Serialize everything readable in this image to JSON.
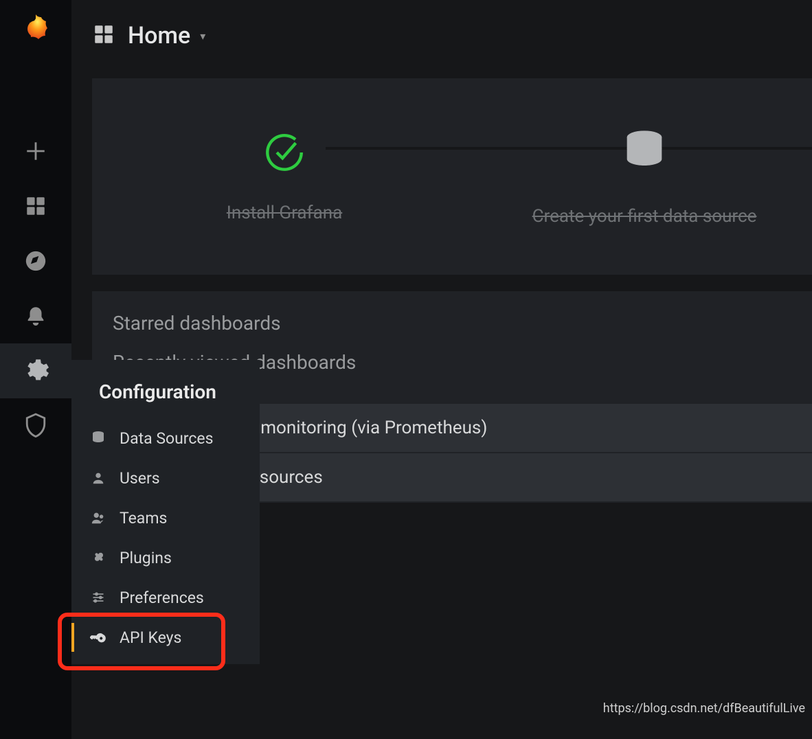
{
  "topbar": {
    "title": "Home"
  },
  "setup": {
    "steps": [
      {
        "label": "Install Grafana",
        "done": true,
        "icon": "check"
      },
      {
        "label": "Create your first data source",
        "done": true,
        "icon": "database"
      }
    ]
  },
  "sections": {
    "starred_title": "Starred dashboards",
    "recent_title": "Recently viewed dashboards",
    "rows": [
      "r monitoring (via Prometheus)",
      "esources"
    ]
  },
  "flyout": {
    "title": "Configuration",
    "items": [
      {
        "label": "Data Sources",
        "icon": "database"
      },
      {
        "label": "Users",
        "icon": "user"
      },
      {
        "label": "Teams",
        "icon": "users"
      },
      {
        "label": "Plugins",
        "icon": "plug"
      },
      {
        "label": "Preferences",
        "icon": "sliders"
      },
      {
        "label": "API Keys",
        "icon": "key",
        "selected": true
      }
    ]
  },
  "watermark": "https://blog.csdn.net/dfBeautifulLive"
}
